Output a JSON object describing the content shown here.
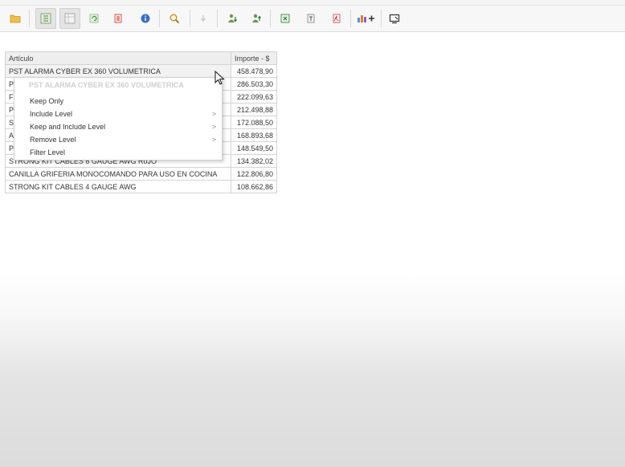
{
  "toolbar": {
    "buttons": [
      {
        "icon": "folder-open-icon",
        "color": "#e8b33c"
      },
      {
        "icon": "export-grid-icon",
        "color": "#5a8f3a"
      },
      {
        "icon": "table-view-icon",
        "color": "#8a8a8a"
      },
      {
        "icon": "refresh-icon",
        "color": "#4a9a4a"
      },
      {
        "icon": "page-break-icon",
        "color": "#c0392b"
      },
      {
        "icon": "info-icon",
        "color": "#3a6fbf"
      },
      {
        "icon": "search-icon",
        "color": "#c08a2a"
      },
      {
        "icon": "arrow-down-icon",
        "color": "#cccccc"
      },
      {
        "icon": "user-download-icon",
        "color": "#4a8a3a"
      },
      {
        "icon": "user-upload-icon",
        "color": "#4a8a3a"
      },
      {
        "icon": "excel-icon",
        "color": "#2e7d32"
      },
      {
        "icon": "text-export-icon",
        "color": "#6d6d6d"
      },
      {
        "icon": "pdf-icon",
        "color": "#d32f2f"
      },
      {
        "icon": "add-chart-icon",
        "color": "#d9822b"
      },
      {
        "icon": "fullscreen-icon",
        "color": "#333333"
      }
    ]
  },
  "table": {
    "headers": {
      "articulo": "Artículo",
      "importe": "Importe - $"
    },
    "rows": [
      {
        "articulo": "PST ALARMA CYBER EX 360 VOLUMETRICA",
        "importe": "458.478,90"
      },
      {
        "articulo": "P",
        "importe": "286.503,30"
      },
      {
        "articulo": "F",
        "importe": "222.099,63"
      },
      {
        "articulo": "P",
        "importe": "212.498,88"
      },
      {
        "articulo": "S",
        "importe": "172.088,50"
      },
      {
        "articulo": "A",
        "importe": "168.893,68"
      },
      {
        "articulo": "P",
        "importe": "148.549,50"
      },
      {
        "articulo": "STRONG KIT CABLES 6 GAUGE AWG RoJO",
        "importe": "134.382,02"
      },
      {
        "articulo": "CANILLA GRIFERIA MONOCOMANDO PARA USO EN COCINA",
        "importe": "122.806,80"
      },
      {
        "articulo": "STRONG KIT CABLES 4 GAUGE AWG",
        "importe": "108.662,86"
      }
    ]
  },
  "context_menu": {
    "header": "PST ALARMA CYBER EX 360 VOLUMETRICA",
    "items": [
      {
        "label": "Keep Only",
        "submenu": false
      },
      {
        "label": "Include Level",
        "submenu": true
      },
      {
        "label": "Keep and Include Level",
        "submenu": true
      },
      {
        "label": "Remove Level",
        "submenu": true
      },
      {
        "label": "Filter Level",
        "submenu": false
      }
    ],
    "submenu_arrow": ">"
  }
}
